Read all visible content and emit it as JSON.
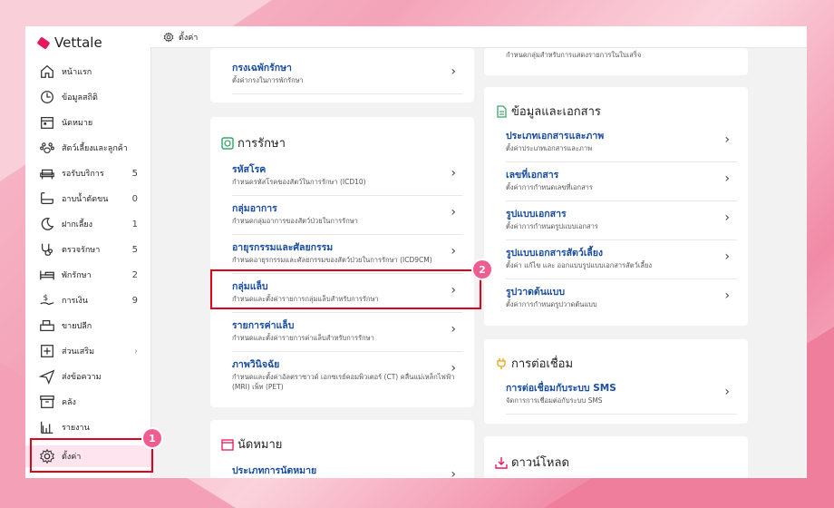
{
  "app": {
    "name": "Vettale"
  },
  "topbar": {
    "title": "ตั้งค่า"
  },
  "sidebar": {
    "items": [
      {
        "label": "หน้าแรก",
        "count": "",
        "icon": "home-icon"
      },
      {
        "label": "ข้อมูลสถิติ",
        "count": "",
        "icon": "stats-icon"
      },
      {
        "label": "นัดหมาย",
        "count": "",
        "icon": "calendar-icon"
      },
      {
        "label": "สัตว์เลี้ยงและลูกค้า",
        "count": "",
        "icon": "paw-icon"
      },
      {
        "label": "รอรับบริการ",
        "count": "5",
        "icon": "sofa-icon"
      },
      {
        "label": "อาบน้ำตัดขน",
        "count": "0",
        "icon": "bathtub-icon"
      },
      {
        "label": "ฝากเลี้ยง",
        "count": "1",
        "icon": "moon-icon"
      },
      {
        "label": "ตรวจรักษา",
        "count": "5",
        "icon": "stethoscope-icon"
      },
      {
        "label": "พักรักษา",
        "count": "2",
        "icon": "bed-icon"
      },
      {
        "label": "การเงิน",
        "count": "9",
        "icon": "money-icon"
      },
      {
        "label": "ขายปลีก",
        "count": "",
        "icon": "register-icon"
      },
      {
        "label": "ส่วนเสริม",
        "count": "›",
        "icon": "plus-box-icon"
      },
      {
        "label": "ส่งข้อความ",
        "count": "",
        "icon": "send-icon"
      },
      {
        "label": "คลัง",
        "count": "",
        "icon": "archive-icon"
      },
      {
        "label": "รายงาน",
        "count": "",
        "icon": "report-icon"
      },
      {
        "label": "ตั้งค่า",
        "count": "",
        "icon": "gear-icon"
      }
    ]
  },
  "left_top_card": {
    "rows": [
      {
        "title": "กรงเฉพักรักษา",
        "desc": "ตั้งค่ากรงในการพักรักษา"
      }
    ]
  },
  "treatment_card": {
    "title": "การรักษา",
    "rows": [
      {
        "title": "รหัสโรค",
        "desc": "กำหนดรหัสโรคของสัตว์ในการรักษา (ICD10)"
      },
      {
        "title": "กลุ่มอาการ",
        "desc": "กำหนดกลุ่มอาการของสัตว์ป่วยในการรักษา"
      },
      {
        "title": "อายุรกรรมและศัลยกรรม",
        "desc": "กำหนดอายุรกรรมและศัลยกรรมของสัตว์ป่วยในการรักษา (ICD9CM)"
      },
      {
        "title": "กลุ่มแล็บ",
        "desc": "กำหนดและตั้งค่ารายการกลุ่มแล็บสำหรับการรักษา"
      },
      {
        "title": "รายการค่าแล็บ",
        "desc": "กำหนดและตั้งค่ารายการค่าแล็บสำหรับการรักษา"
      },
      {
        "title": "ภาพวินิจฉัย",
        "desc": "กำหนดและตั้งค่าอัลตราซาวด์ เอกซเรย์คอมพิวเตอร์ (CT) คลื่นแม่เหล็กไฟฟ้า (MRI) เพ็ท (PET)"
      }
    ]
  },
  "appointment_card": {
    "title": "นัดหมาย",
    "rows": [
      {
        "title": "ประเภทการนัดหมาย",
        "desc": ""
      }
    ]
  },
  "right_top_card": {
    "desc": "กำหนดกลุ่มสำหรับการแสดงรายการในใบเสร็จ"
  },
  "documents_card": {
    "title": "ข้อมูลและเอกสาร",
    "rows": [
      {
        "title": "ประเภทเอกสารและภาพ",
        "desc": "ตั้งค่าประเภทเอกสารและภาพ"
      },
      {
        "title": "เลขที่เอกสาร",
        "desc": "ตั้งค่าการกำหนดเลขที่เอกสาร"
      },
      {
        "title": "รูปแบบเอกสาร",
        "desc": "ตั้งค่าการกำหนดรูปแบบเอกสาร"
      },
      {
        "title": "รูปแบบเอกสารสัตว์เลี้ยง",
        "desc": "ตั้งค่า แก้ไข และ ออกแบบรูปแบบเอกสารสัตว์เลี้ยง"
      },
      {
        "title": "รูปวาดต้นแบบ",
        "desc": "ตั้งค่าการกำหนดรูปวาดต้นแบบ"
      }
    ]
  },
  "connection_card": {
    "title": "การต่อเชื่อม",
    "rows": [
      {
        "title": "การต่อเชื่อมกับระบบ SMS",
        "desc": "จัดการการเชื่อมต่อกับระบบ SMS"
      }
    ]
  },
  "download_card": {
    "title": "ดาวน์โหลด"
  },
  "badges": {
    "one": "1",
    "two": "2"
  },
  "colors": {
    "accent": "#e8175d",
    "link": "#1b4ea0",
    "highlight": "#e3001b",
    "badge": "#ef5d90",
    "active_bg": "#fde4ee",
    "treat_icon": "#3aa86b"
  }
}
